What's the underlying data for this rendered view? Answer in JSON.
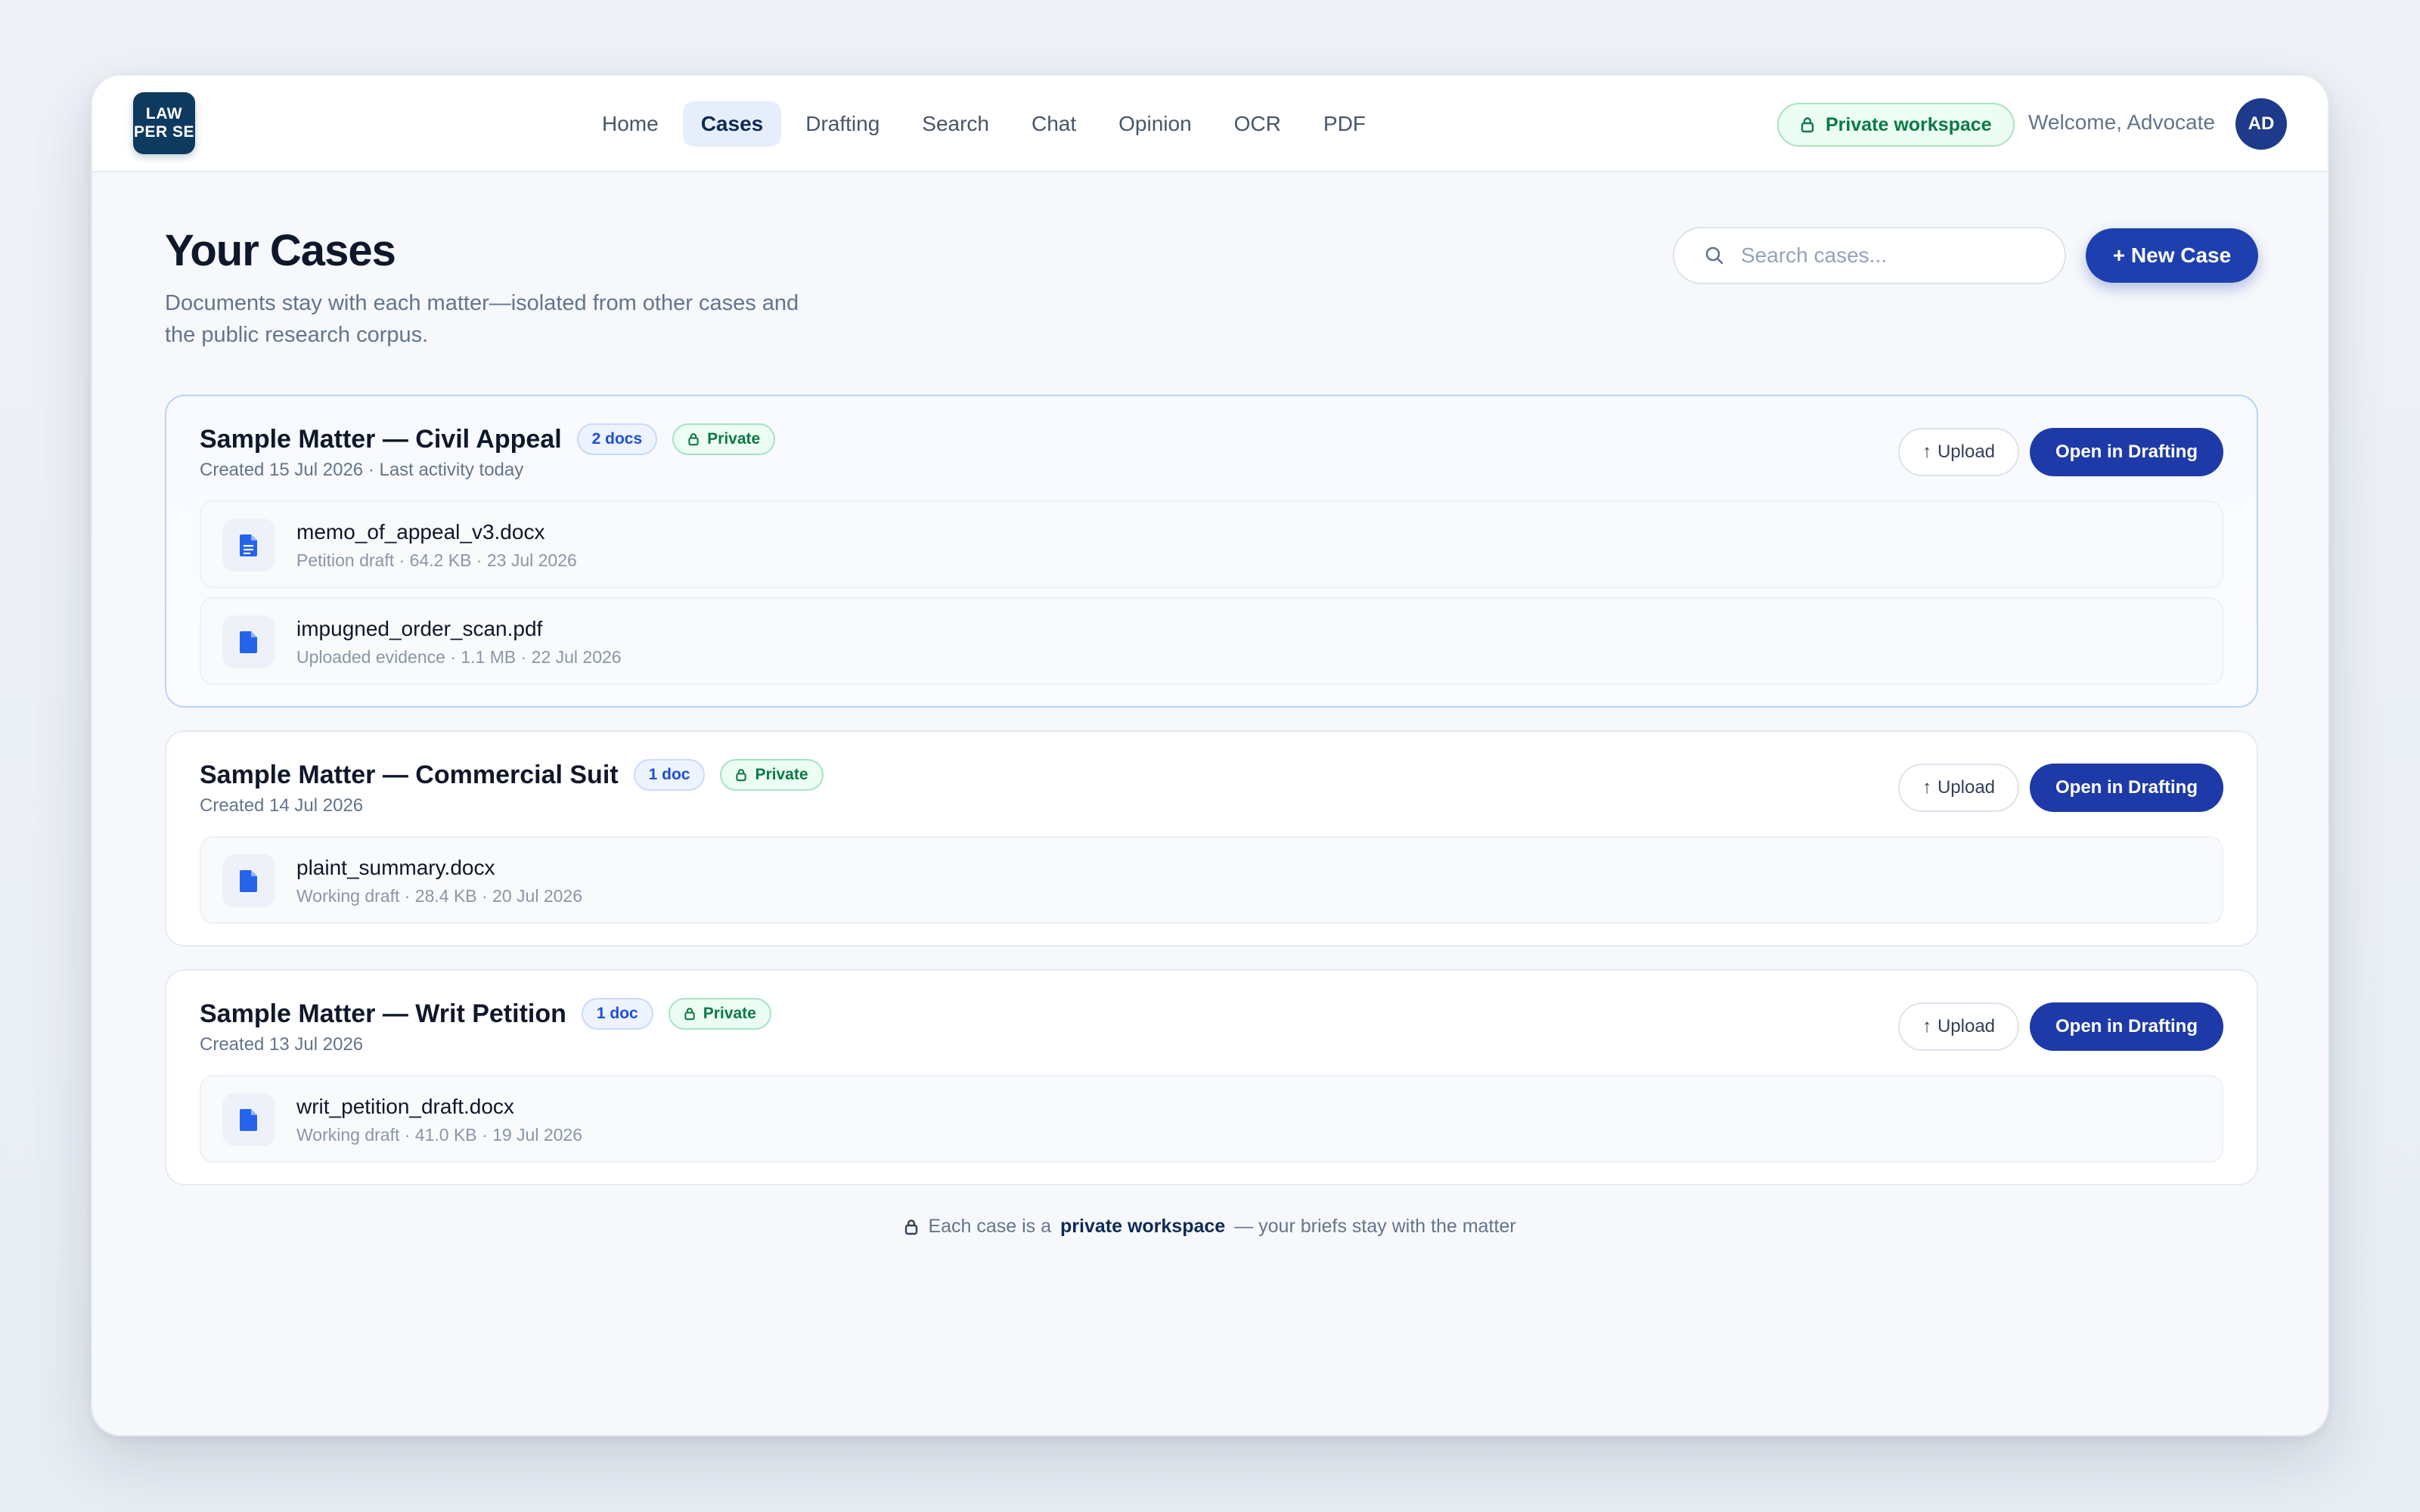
{
  "brand": {
    "line1": "LAW",
    "line2": "PER SE"
  },
  "nav": {
    "items": [
      {
        "label": "Home",
        "active": false
      },
      {
        "label": "Cases",
        "active": true
      },
      {
        "label": "Drafting",
        "active": false
      },
      {
        "label": "Search",
        "active": false
      },
      {
        "label": "Chat",
        "active": false
      },
      {
        "label": "Opinion",
        "active": false
      },
      {
        "label": "OCR",
        "active": false
      },
      {
        "label": "PDF",
        "active": false
      }
    ]
  },
  "header": {
    "workspace_badge": "Private workspace",
    "welcome": "Welcome, Advocate",
    "avatar_initials": "AD"
  },
  "page": {
    "title": "Your Cases",
    "subtitle": "Documents stay with each matter—isolated from other cases and the public research corpus.",
    "search_placeholder": "Search cases...",
    "new_case_label": "+ New Case"
  },
  "actions": {
    "upload_label": "Upload",
    "open_label": "Open in Drafting"
  },
  "cases": [
    {
      "name": "Sample Matter — Civil Appeal",
      "docs_badge": "2 docs",
      "private_badge": "Private",
      "meta": "Created 15 Jul 2026 · Last activity today",
      "documents": [
        {
          "name": "memo_of_appeal_v3.docx",
          "meta": "Petition draft · 64.2 KB · 23 Jul 2026",
          "icon": "document-lines-icon"
        },
        {
          "name": "impugned_order_scan.pdf",
          "meta": "Uploaded evidence · 1.1 MB · 22 Jul 2026",
          "icon": "document-icon"
        }
      ]
    },
    {
      "name": "Sample Matter — Commercial Suit",
      "docs_badge": "1 doc",
      "private_badge": "Private",
      "meta": "Created 14 Jul 2026",
      "documents": [
        {
          "name": "plaint_summary.docx",
          "meta": "Working draft · 28.4 KB · 20 Jul 2026",
          "icon": "document-icon"
        }
      ]
    },
    {
      "name": "Sample Matter — Writ Petition",
      "docs_badge": "1 doc",
      "private_badge": "Private",
      "meta": "Created 13 Jul 2026",
      "documents": [
        {
          "name": "writ_petition_draft.docx",
          "meta": "Working draft · 41.0 KB · 19 Jul 2026",
          "icon": "document-icon"
        }
      ]
    }
  ],
  "footer": {
    "prefix": "Each case is a",
    "emphasis": "private workspace",
    "suffix": "— your briefs stay with the matter"
  },
  "colors": {
    "primary": "#1e40af",
    "success": "#0b7a45",
    "logo_bg": "#0f3a5f",
    "doc_icon": "#2563eb"
  }
}
